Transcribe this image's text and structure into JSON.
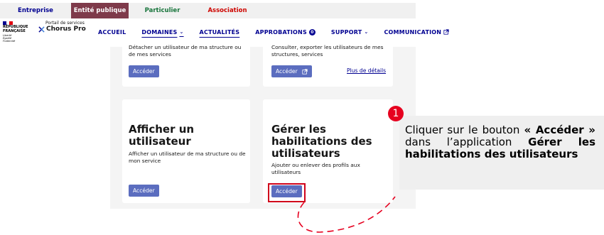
{
  "audience_tabs": [
    "Entreprise",
    "Entité publique",
    "Particulier",
    "Association"
  ],
  "logo": {
    "republic_line1": "RÉPUBLIQUE",
    "republic_line2": "FRANÇAISE",
    "motto": [
      "Liberté",
      "Égalité",
      "Fraternité"
    ],
    "portal_small": "Portail de services",
    "portal_name": "Chorus Pro"
  },
  "nav": {
    "accueil": "ACCUEIL",
    "domaines": "DOMAINES",
    "actualites": "ACTUALITÉS",
    "approbations": "APPROBATIONS",
    "approbations_count": "0",
    "support": "SUPPORT",
    "communication": "COMMUNICATION"
  },
  "cards": {
    "top_left": {
      "description": "Détacher un utilisateur de ma structure ou de mes services",
      "button": "Accéder"
    },
    "top_right": {
      "description": "Consulter, exporter les utilisateurs de mes structures, services",
      "button": "Accéder",
      "link": "Plus de détails"
    },
    "afficher": {
      "title": "Afficher un utilisateur",
      "description": "Afficher un utilisateur de ma structure ou de mon service",
      "button": "Accéder"
    },
    "gerer": {
      "title": "Gérer les habilitations des utilisateurs",
      "description": "Ajouter ou enlever des profils aux utilisateurs",
      "button": "Accéder"
    }
  },
  "callout": {
    "step": "1",
    "text_start": "Cliquer sur le bouton ",
    "bold_button": "« Accéder »",
    "text_mid": " dans l’application ",
    "bold_app": "Gérer les habilitations des utilisateurs"
  },
  "colors": {
    "brand_blue": "#000091",
    "button_blue": "#5b6dbf",
    "highlight_red": "#d0021b",
    "entite_tab": "#7e3a4a"
  }
}
